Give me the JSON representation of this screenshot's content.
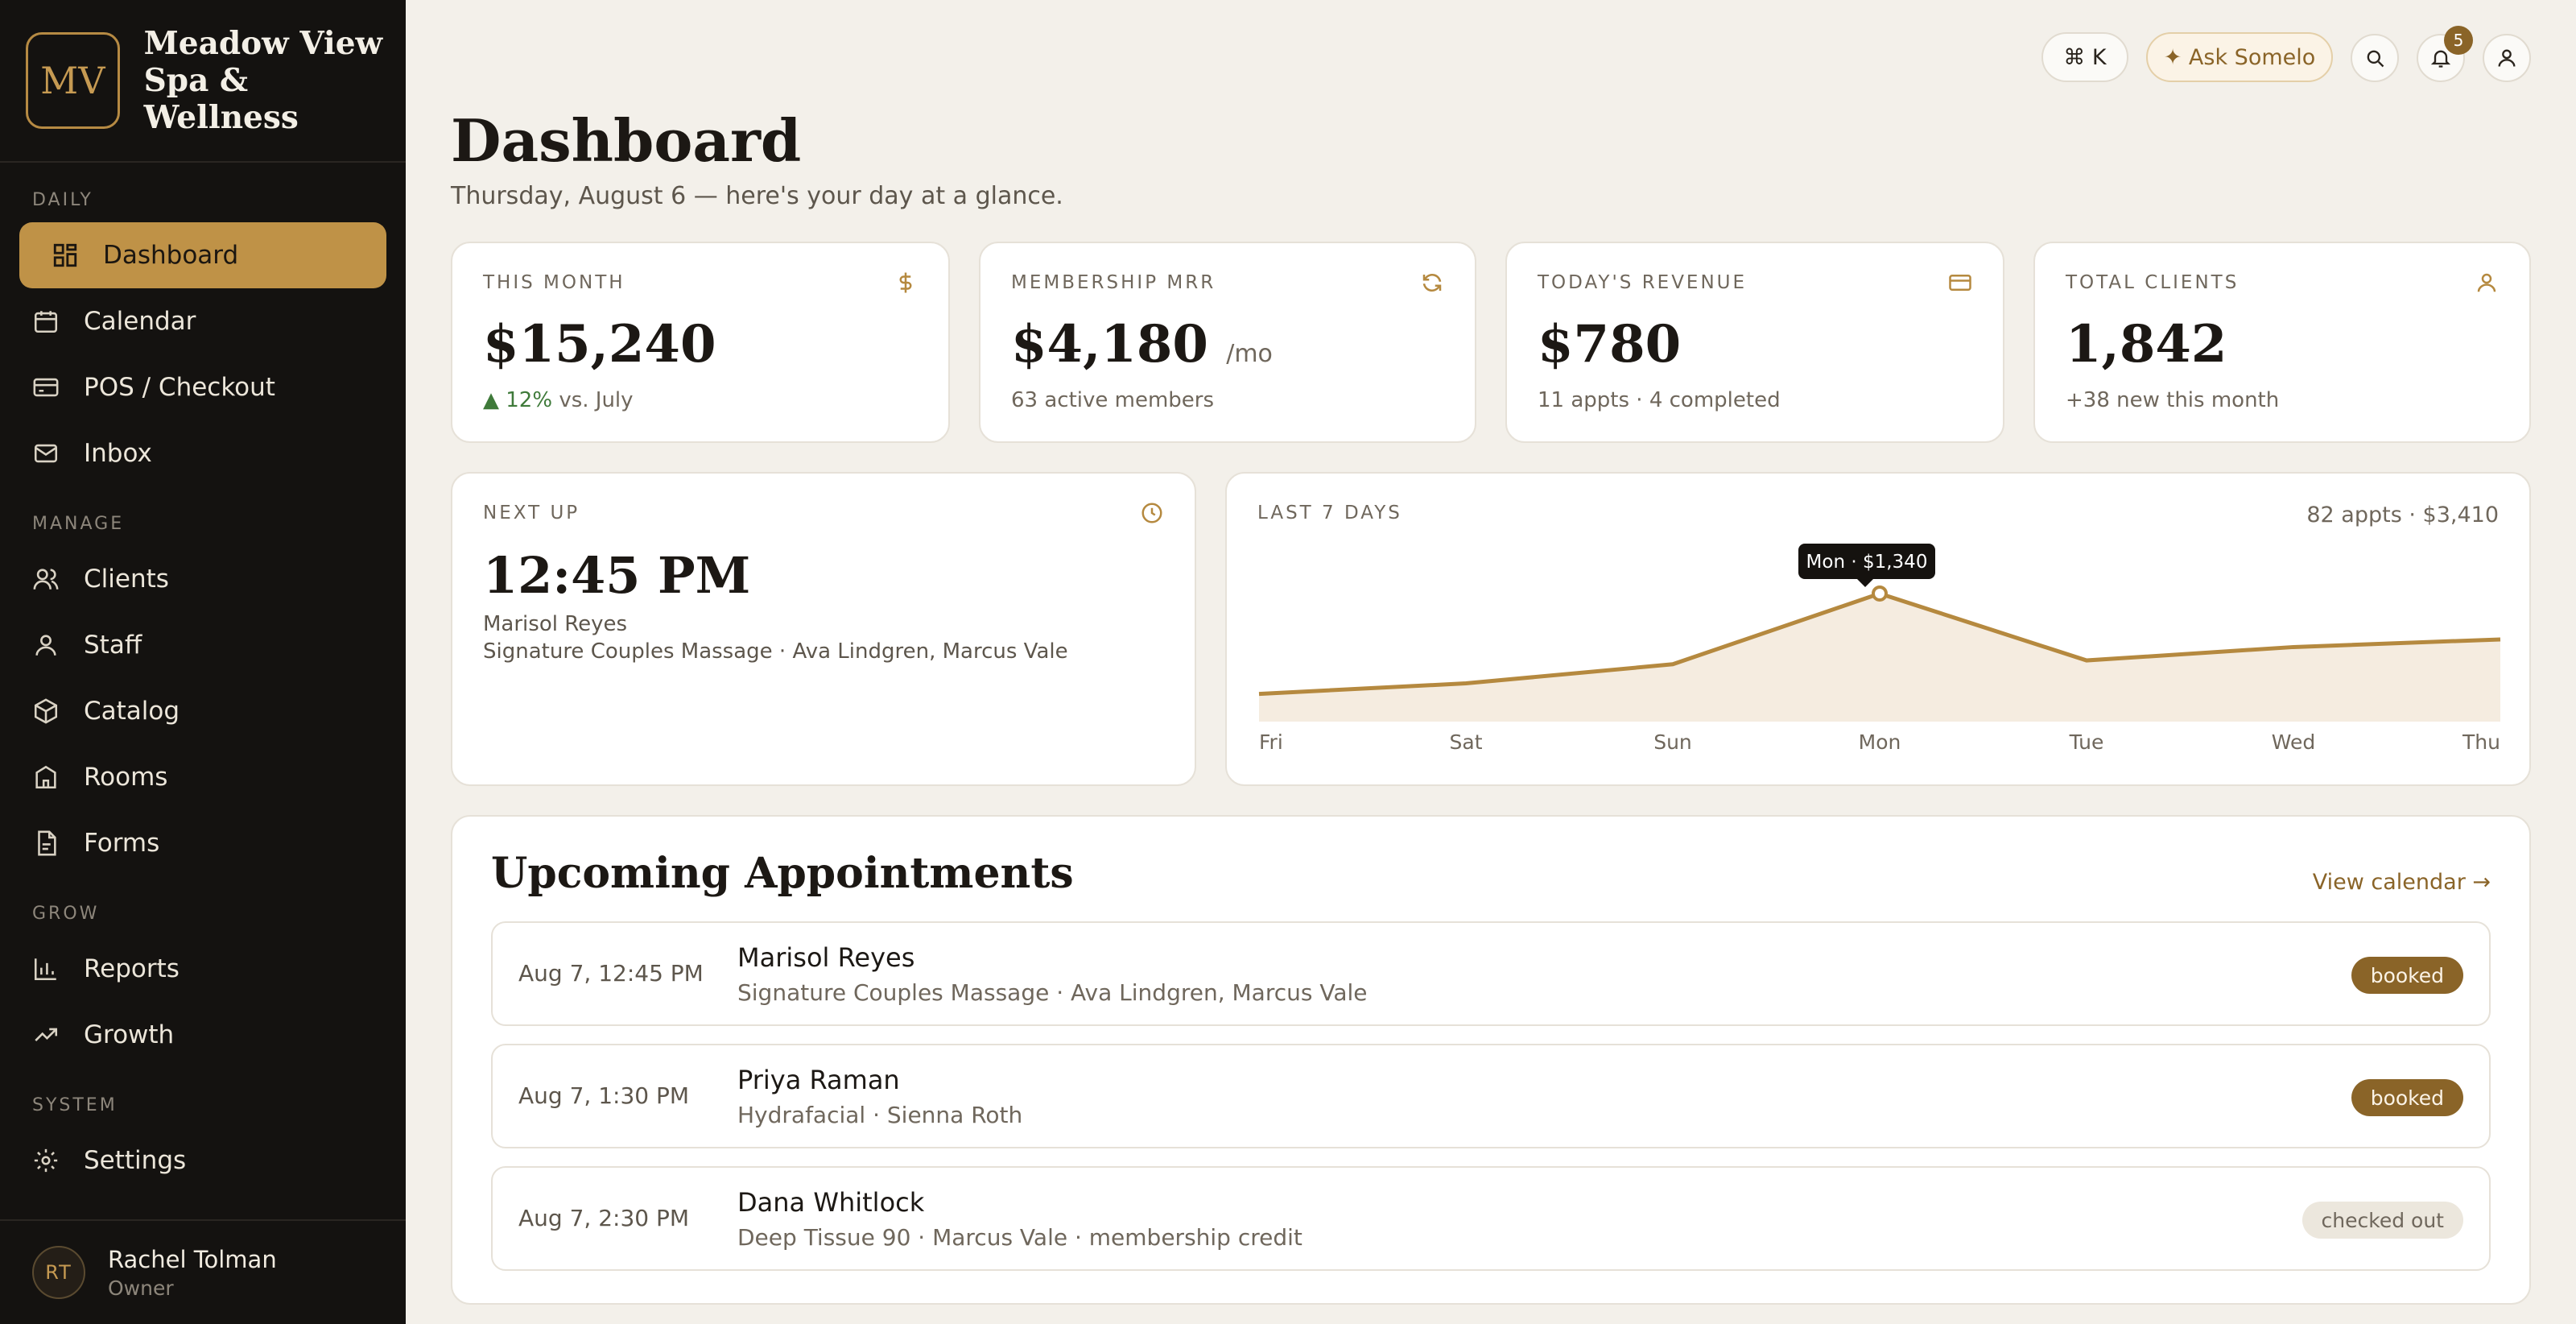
{
  "brand": {
    "initials": "MV",
    "name_line1": "Meadow View",
    "name_line2": "Spa & Wellness"
  },
  "sidebar": {
    "sections": [
      "DAILY",
      "MANAGE",
      "GROW",
      "SYSTEM"
    ],
    "items": [
      {
        "label": "Dashboard",
        "icon": "grid-icon"
      },
      {
        "label": "Calendar",
        "icon": "calendar-icon"
      },
      {
        "label": "POS / Checkout",
        "icon": "credit-card-icon"
      },
      {
        "label": "Inbox",
        "icon": "mail-icon"
      },
      {
        "label": "Clients",
        "icon": "users-icon"
      },
      {
        "label": "Staff",
        "icon": "user-icon"
      },
      {
        "label": "Catalog",
        "icon": "box-icon"
      },
      {
        "label": "Rooms",
        "icon": "building-icon"
      },
      {
        "label": "Forms",
        "icon": "document-icon"
      },
      {
        "label": "Reports",
        "icon": "bar-chart-icon"
      },
      {
        "label": "Growth",
        "icon": "trend-up-icon"
      },
      {
        "label": "Settings",
        "icon": "gear-icon"
      }
    ],
    "active": "Dashboard",
    "user": {
      "initials": "RT",
      "name": "Rachel Tolman",
      "role": "Owner"
    }
  },
  "topbar": {
    "shortcut_label": "⌘ K",
    "ask_label": "✦ Ask Somelo",
    "notification_count": "5"
  },
  "header": {
    "title": "Dashboard",
    "subtitle": "Thursday, August 6 — here's your day at a glance."
  },
  "stats": [
    {
      "label": "THIS MONTH",
      "value": "$15,240",
      "foot_up": "▲ 12%",
      "foot": " vs. July",
      "icon": "dollar-icon"
    },
    {
      "label": "MEMBERSHIP MRR",
      "value": "$4,180",
      "unit": "/mo",
      "foot": "63 active members",
      "icon": "refresh-icon"
    },
    {
      "label": "TODAY'S REVENUE",
      "value": "$780",
      "foot": "11 appts · 4 completed",
      "icon": "credit-card-icon"
    },
    {
      "label": "TOTAL CLIENTS",
      "value": "1,842",
      "foot": "+38 new this month",
      "icon": "user-icon"
    }
  ],
  "next_up": {
    "label": "NEXT UP",
    "time": "12:45 PM",
    "client": "Marisol Reyes",
    "detail": "Signature Couples Massage · Ava Lindgren, Marcus Vale"
  },
  "chart": {
    "label": "LAST 7 DAYS",
    "summary": "82 appts · $3,410",
    "tooltip": "Mon · $1,340"
  },
  "chart_data": {
    "type": "area",
    "categories": [
      "Fri",
      "Sat",
      "Sun",
      "Mon",
      "Tue",
      "Wed",
      "Thu"
    ],
    "values": [
      290,
      400,
      600,
      1340,
      640,
      780,
      860
    ],
    "highlight": {
      "category": "Mon",
      "value": 1340
    },
    "color": "#b5893f",
    "fill": "#f5ece0"
  },
  "appointments": {
    "title": "Upcoming Appointments",
    "link": "View calendar →",
    "rows": [
      {
        "time": "Aug 7, 12:45 PM",
        "name": "Marisol Reyes",
        "detail": "Signature Couples Massage · Ava Lindgren, Marcus Vale",
        "status": "booked"
      },
      {
        "time": "Aug 7, 1:30 PM",
        "name": "Priya Raman",
        "detail": "Hydrafacial · Sienna Roth",
        "status": "booked"
      },
      {
        "time": "Aug 7, 2:30 PM",
        "name": "Dana Whitlock",
        "detail": "Deep Tissue 90 · Marcus Vale · membership credit",
        "status": "checked out"
      }
    ]
  }
}
